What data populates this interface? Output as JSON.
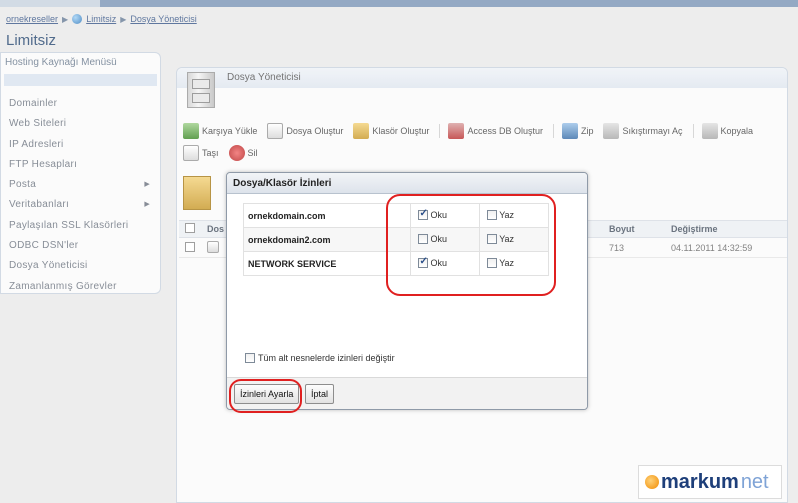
{
  "breadcrumb": {
    "item1": "ornekreseller",
    "item2": "Limitsiz",
    "item3": "Dosya Yöneticisi"
  },
  "page_title": "Limitsiz",
  "sidebar": {
    "title": "Hosting Kaynağı Menüsü",
    "items": [
      {
        "label": "Domainler",
        "arrow": ""
      },
      {
        "label": "Web Siteleri",
        "arrow": ""
      },
      {
        "label": "IP Adresleri",
        "arrow": ""
      },
      {
        "label": "FTP Hesapları",
        "arrow": ""
      },
      {
        "label": "Posta",
        "arrow": "▶"
      },
      {
        "label": "Veritabanları",
        "arrow": "▶"
      },
      {
        "label": "Paylaşılan SSL Klasörleri",
        "arrow": ""
      },
      {
        "label": "ODBC DSN'ler",
        "arrow": ""
      },
      {
        "label": "Dosya Yöneticisi",
        "arrow": ""
      },
      {
        "label": "Zamanlanmış Görevler",
        "arrow": ""
      }
    ]
  },
  "panel": {
    "title": "Dosya Yöneticisi"
  },
  "toolbar": {
    "upload": "Karşıya Yükle",
    "new_file": "Dosya Oluştur",
    "new_folder": "Klasör Oluştur",
    "access_db": "Access DB Oluştur",
    "zip": "Zip",
    "unzip": "Sıkıştırmayı Aç",
    "copy": "Kopyala",
    "move": "Taşı",
    "delete": "Sil"
  },
  "grid": {
    "col_name": "Dos",
    "col_size": "Boyut",
    "col_modified": "Değiştirme",
    "row1_size": "713",
    "row1_modified": "04.11.2011 14:32:59"
  },
  "dialog": {
    "title": "Dosya/Klasör İzinleri",
    "permissions": [
      {
        "user": "ornekdomain.com",
        "read_label": "Oku",
        "write_label": "Yaz",
        "read": true,
        "write": false
      },
      {
        "user": "ornekdomain2.com",
        "read_label": "Oku",
        "write_label": "Yaz",
        "read": false,
        "write": false
      },
      {
        "user": "NETWORK SERVICE",
        "read_label": "Oku",
        "write_label": "Yaz",
        "read": true,
        "write": false
      }
    ],
    "subobjects_label": "Tüm alt nesnelerde izinleri değiştir",
    "set_button": "İzinleri Ayarla",
    "cancel_button": "İptal"
  },
  "brand": {
    "part1": "markum",
    "part2": "net"
  },
  "colors": {
    "highlight": "#e02020",
    "accent": "#2b4b73"
  }
}
